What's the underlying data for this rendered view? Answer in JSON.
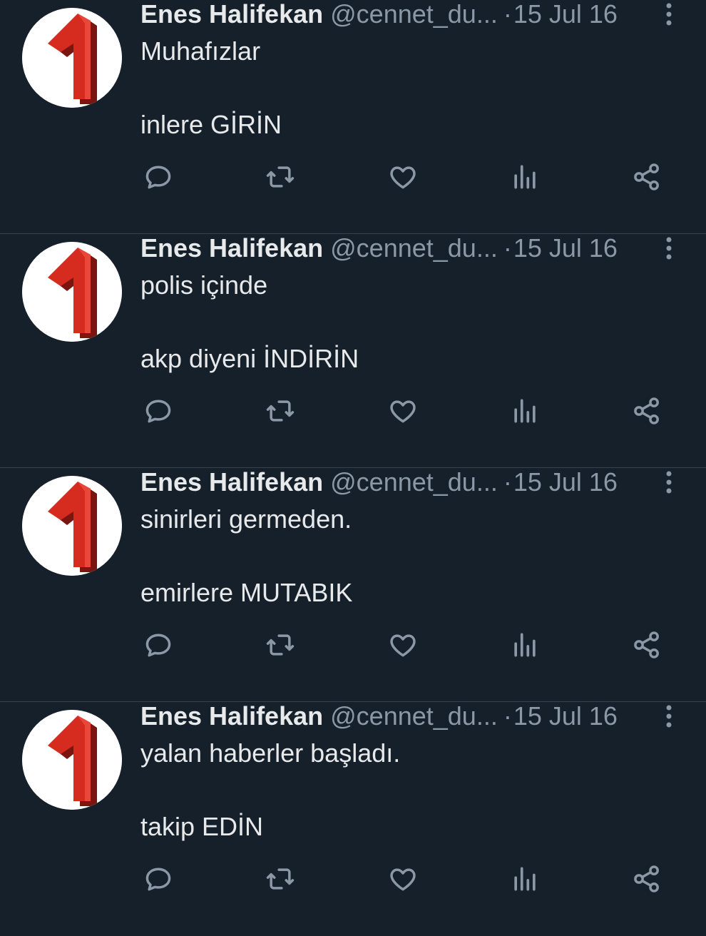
{
  "colors": {
    "background": "#15202b",
    "text": "#e7e9ea",
    "secondary_text": "#8b98a5",
    "divider": "#38444d",
    "avatar_red": "#d62b1f"
  },
  "avatar": {
    "glyph": "1"
  },
  "icons": [
    "reply-icon",
    "retweet-icon",
    "like-icon",
    "views-icon",
    "share-icon",
    "more-options-icon"
  ],
  "tweets": [
    {
      "name": "Enes Halifekan",
      "handle": "@cennet_du...",
      "separator": "·",
      "date": "15 Jul 16",
      "line1": "Muhafızlar",
      "line2": "inlere GİRİN"
    },
    {
      "name": "Enes Halifekan",
      "handle": "@cennet_du...",
      "separator": "·",
      "date": "15 Jul 16",
      "line1": "polis içinde",
      "line2": "akp diyeni İNDİRİN"
    },
    {
      "name": "Enes Halifekan",
      "handle": "@cennet_du...",
      "separator": "·",
      "date": "15 Jul 16",
      "line1": "sinirleri germeden.",
      "line2": "emirlere MUTABIK"
    },
    {
      "name": "Enes Halifekan",
      "handle": "@cennet_du...",
      "separator": "·",
      "date": "15 Jul 16",
      "line1": "yalan haberler başladı.",
      "line2": "takip EDİN"
    }
  ]
}
